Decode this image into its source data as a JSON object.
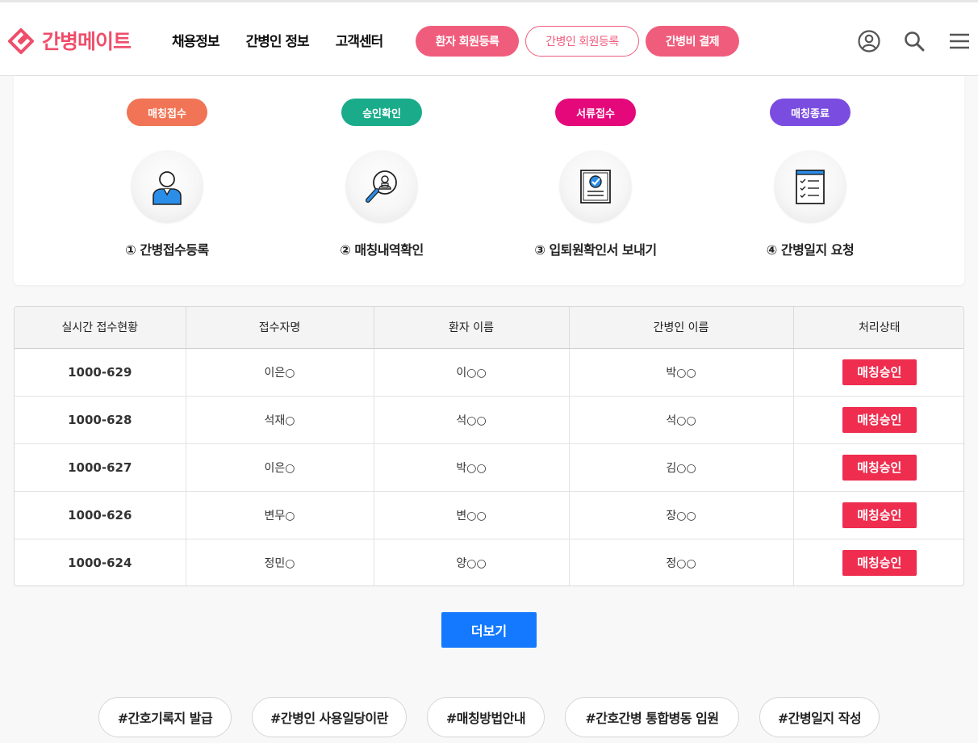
{
  "header": {
    "logo_text": "간병메이트",
    "nav": [
      "채용정보",
      "간병인 정보",
      "고객센터"
    ],
    "buttons": {
      "patient_register": "환자 회원등록",
      "caregiver_register": "간병인 회원등록",
      "payment": "간병비 결제"
    },
    "icons": [
      "user-circle-icon",
      "search-icon",
      "menu-icon"
    ],
    "brand_color": "#f05d7c"
  },
  "steps": [
    {
      "badge": "매칭접수",
      "badge_color": "#f07455",
      "icon": "person-icon",
      "label": "① 간병접수등록"
    },
    {
      "badge": "승인확인",
      "badge_color": "#1aab8b",
      "icon": "magnifier-person-icon",
      "label": "② 매칭내역확인"
    },
    {
      "badge": "서류접수",
      "badge_color": "#e4087b",
      "icon": "document-check-icon",
      "label": "③ 입퇴원확인서 보내기"
    },
    {
      "badge": "매칭종료",
      "badge_color": "#7a4de0",
      "icon": "checklist-icon",
      "label": "④ 간병일지 요청"
    }
  ],
  "table": {
    "headers": [
      "실시간 접수현황",
      "접수자명",
      "환자 이름",
      "간병인 이름",
      "처리상태"
    ],
    "rows": [
      [
        "1000-629",
        "이은○",
        "이○○",
        "박○○",
        "매칭승인"
      ],
      [
        "1000-628",
        "석재○",
        "석○○",
        "석○○",
        "매칭승인"
      ],
      [
        "1000-627",
        "이은○",
        "박○○",
        "김○○",
        "매칭승인"
      ],
      [
        "1000-626",
        "변무○",
        "변○○",
        "장○○",
        "매칭승인"
      ],
      [
        "1000-624",
        "정민○",
        "양○○",
        "정○○",
        "매칭승인"
      ]
    ]
  },
  "more_button": "더보기",
  "tags": [
    "#간호기록지 발급",
    "#간병인 사용일당이란",
    "#매칭방법안내",
    "#간호간병 통합병동 입원",
    "#간병일지 작성"
  ]
}
